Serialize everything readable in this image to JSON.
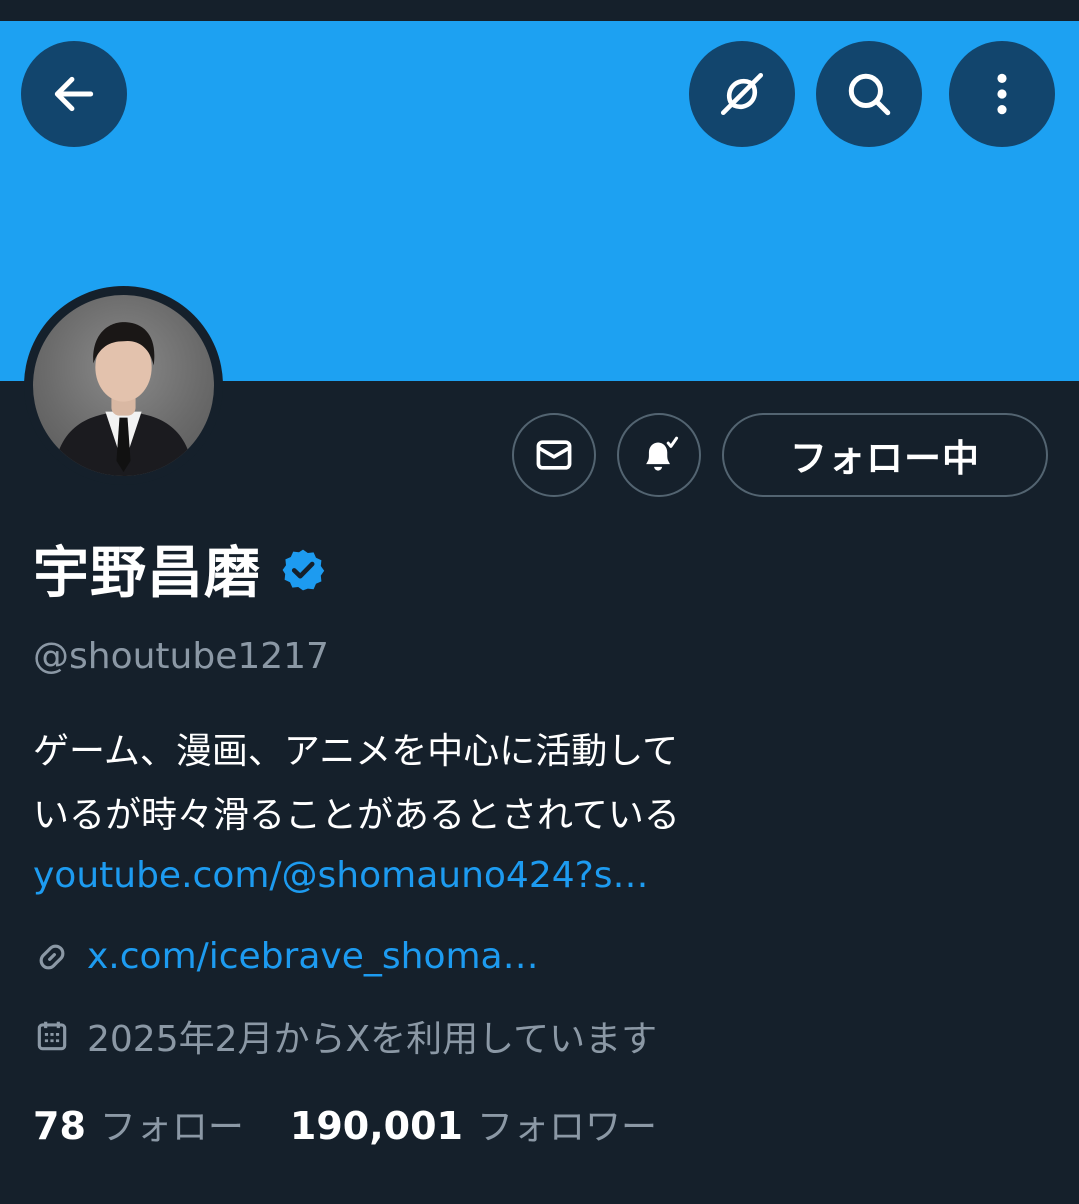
{
  "header": {
    "back_icon": "arrow-left-icon",
    "grok_icon": "grok-icon",
    "search_icon": "search-icon",
    "more_icon": "more-vertical-icon",
    "banner_color": "#1da1f2"
  },
  "actions": {
    "dm_icon": "envelope-icon",
    "notify_icon": "bell-check-icon",
    "follow_label": "フォロー中"
  },
  "profile": {
    "display_name": "宇野昌磨",
    "verified": true,
    "handle": "@shoutube1217",
    "bio_lines": [
      "ゲーム、漫画、アニメを中心に活動して",
      "いるが時々滑ることがあるとされている"
    ],
    "bio_link": "youtube.com/@shomauno424?s…",
    "website": "x.com/icebrave_shoma…",
    "joined": "2025年2月からXを利用しています"
  },
  "stats": {
    "following_count": "78",
    "following_label": "フォロー",
    "followers_count": "190,001",
    "followers_label": "フォロワー"
  },
  "colors": {
    "background": "#15202b",
    "accent": "#1d9bf0",
    "muted_text": "#8b98a5"
  }
}
